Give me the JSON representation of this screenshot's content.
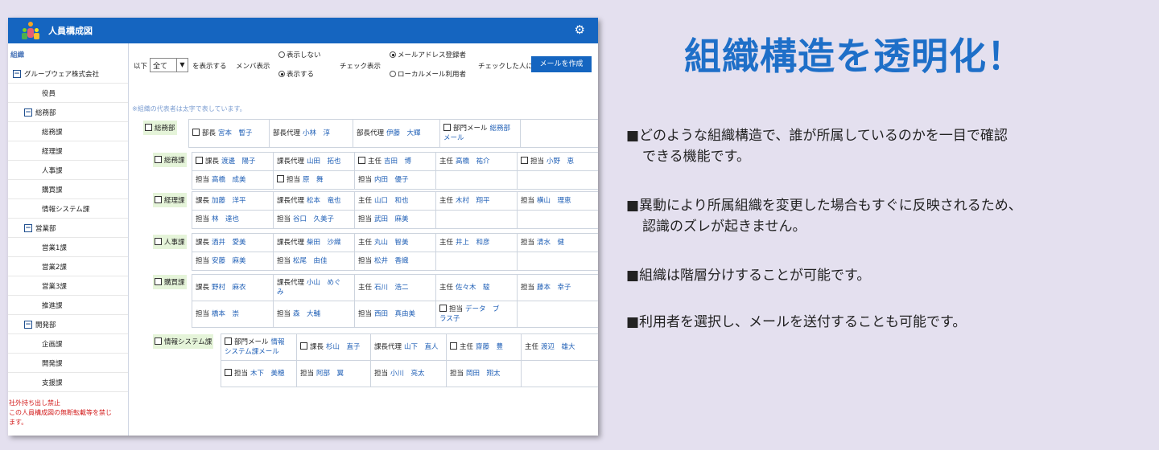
{
  "window": {
    "title": "人員構成図"
  },
  "sidebar": {
    "heading": "組織",
    "items": [
      {
        "label": "グループウェア株式会社",
        "level": 0,
        "toggle": "−"
      },
      {
        "label": "役員",
        "level": 2
      },
      {
        "label": "総務部",
        "level": 1,
        "toggle": "−"
      },
      {
        "label": "総務課",
        "level": 2
      },
      {
        "label": "経理課",
        "level": 2
      },
      {
        "label": "人事課",
        "level": 2
      },
      {
        "label": "購買課",
        "level": 2
      },
      {
        "label": "情報システム課",
        "level": 2
      },
      {
        "label": "営業部",
        "level": 1,
        "toggle": "−"
      },
      {
        "label": "営業1課",
        "level": 2
      },
      {
        "label": "営業2課",
        "level": 2
      },
      {
        "label": "営業3課",
        "level": 2
      },
      {
        "label": "推進課",
        "level": 2
      },
      {
        "label": "開発部",
        "level": 1,
        "toggle": "−"
      },
      {
        "label": "企画課",
        "level": 2
      },
      {
        "label": "開発課",
        "level": 2
      },
      {
        "label": "支援課",
        "level": 2
      }
    ],
    "footer": [
      "社外持ち出し禁止",
      "この人員構成図の無断転載等を禁じ",
      "ます。"
    ]
  },
  "controls": {
    "prefix": "以下",
    "select_value": "全て",
    "suffix": "を表示する",
    "member_label": "メンバ表示",
    "member_hide": "表示しない",
    "member_show": "表示する",
    "check_label": "チェック表示",
    "check_opt1": "メールアドレス登録者",
    "check_opt2": "ローカルメール利用者",
    "checked_label": "チェックした人に",
    "create_mail": "メールを作成"
  },
  "note": "※組織の代表者は太字で表しています。",
  "departments": [
    {
      "name": "総務部",
      "rows": [
        [
          {
            "t": "部長",
            "n": "宮本　暫子",
            "cb": true
          },
          {
            "t": "部長代理",
            "n": "小林　淳"
          },
          {
            "t": "部長代理",
            "n": "伊藤　大輝"
          },
          {
            "t": "部門メール",
            "n": "総務部",
            "n2": "メール",
            "cb": true
          },
          {
            "t": "",
            "n": ""
          }
        ]
      ]
    },
    {
      "name": "総務課",
      "rows": [
        [
          {
            "t": "課長",
            "n": "渡邊　陽子",
            "cb": true
          },
          {
            "t": "課長代理",
            "n": "山田　拓也"
          },
          {
            "t": "主任",
            "n": "吉田　博",
            "cb": true
          },
          {
            "t": "主任",
            "n": "高橋　祐介"
          },
          {
            "t": "担当",
            "n": "小野　恵",
            "cb": true
          }
        ],
        [
          {
            "t": "担当",
            "n": "高橋　成美"
          },
          {
            "t": "担当",
            "n": "原　舞",
            "cb": true
          },
          {
            "t": "担当",
            "n": "内田　優子"
          },
          {
            "t": "",
            "n": ""
          },
          {
            "t": "",
            "n": ""
          }
        ]
      ]
    },
    {
      "name": "経理課",
      "rows": [
        [
          {
            "t": "課長",
            "n": "加藤　洋平"
          },
          {
            "t": "課長代理",
            "n": "松本　竜也"
          },
          {
            "t": "主任",
            "n": "山口　和也"
          },
          {
            "t": "主任",
            "n": "木村　翔平"
          },
          {
            "t": "担当",
            "n": "横山　理恵"
          }
        ],
        [
          {
            "t": "担当",
            "n": "林　達也"
          },
          {
            "t": "担当",
            "n": "谷口　久美子"
          },
          {
            "t": "担当",
            "n": "武田　麻美"
          },
          {
            "t": "",
            "n": ""
          },
          {
            "t": "",
            "n": ""
          }
        ]
      ]
    },
    {
      "name": "人事課",
      "rows": [
        [
          {
            "t": "課長",
            "n": "酒井　愛美"
          },
          {
            "t": "課長代理",
            "n": "柴田　沙織"
          },
          {
            "t": "主任",
            "n": "丸山　智美"
          },
          {
            "t": "主任",
            "n": "井上　和彦"
          },
          {
            "t": "担当",
            "n": "清水　健"
          }
        ],
        [
          {
            "t": "担当",
            "n": "安藤　麻美"
          },
          {
            "t": "担当",
            "n": "松尾　由佳"
          },
          {
            "t": "担当",
            "n": "松井　香織"
          },
          {
            "t": "",
            "n": ""
          },
          {
            "t": "",
            "n": ""
          }
        ]
      ]
    },
    {
      "name": "購買課",
      "rows": [
        [
          {
            "t": "課長",
            "n": "野村　麻衣"
          },
          {
            "t": "課長代理",
            "n": "小山　めぐ",
            "n2": "み"
          },
          {
            "t": "主任",
            "n": "石川　浩二"
          },
          {
            "t": "主任",
            "n": "佐々木　駿"
          },
          {
            "t": "担当",
            "n": "藤本　幸子"
          }
        ],
        [
          {
            "t": "担当",
            "n": "橋本　崇"
          },
          {
            "t": "担当",
            "n": "森　大輔"
          },
          {
            "t": "担当",
            "n": "西田　真由美"
          },
          {
            "t": "担当",
            "n": "データ　ブ",
            "n2": "ラス子",
            "cb": true
          },
          {
            "t": "",
            "n": ""
          }
        ]
      ]
    },
    {
      "name": "情報システム課",
      "rows": [
        [
          {
            "t": "部門メール",
            "n": "情報",
            "n2": "システム課メール",
            "cb": true
          },
          {
            "t": "課長",
            "n": "杉山　直子",
            "cb": true
          },
          {
            "t": "課長代理",
            "n": "山下　直人"
          },
          {
            "t": "主任",
            "n": "齋藤　豊",
            "cb": true
          },
          {
            "t": "主任",
            "n": "渡辺　雄大"
          }
        ],
        [
          {
            "t": "担当",
            "n": "木下　美穂",
            "cb": true
          },
          {
            "t": "担当",
            "n": "阿部　翼"
          },
          {
            "t": "担当",
            "n": "小川　亮太"
          },
          {
            "t": "担当",
            "n": "岡田　翔太"
          },
          {
            "t": "",
            "n": ""
          }
        ]
      ]
    }
  ],
  "headline": "組織構造を透明化！",
  "bullets": [
    {
      "lines": [
        "■どのような組織構造で、誰が所属しているのかを一目で確認",
        "できる機能です。"
      ]
    },
    {
      "lines": [
        "■異動により所属組織を変更した場合もすぐに反映されるため、",
        "認識のズレが起きません。"
      ]
    },
    {
      "lines": [
        "■組織は階層分けすることが可能です。"
      ]
    },
    {
      "lines": [
        "■利用者を選択し、メールを送付することも可能です。"
      ]
    }
  ]
}
